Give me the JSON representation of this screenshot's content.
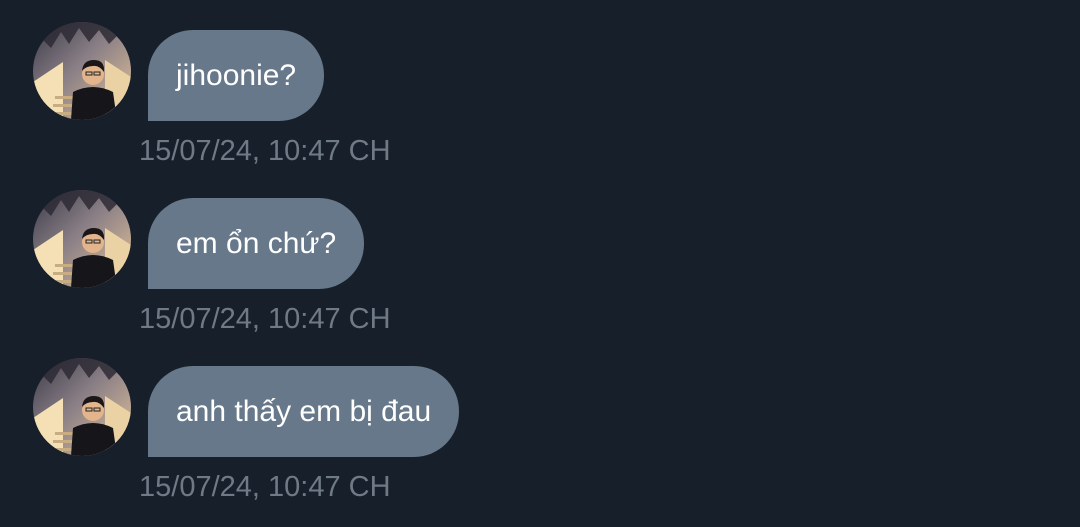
{
  "colors": {
    "background": "#17202a",
    "bubble": "#66788a",
    "bubble_text": "#ffffff",
    "timestamp": "#6f7a86"
  },
  "messages": [
    {
      "text": "jihoonie?",
      "time": "15/07/24, 10:47 CH",
      "avatar": "user-photo"
    },
    {
      "text": "em ổn chứ?",
      "time": "15/07/24, 10:47 CH",
      "avatar": "user-photo"
    },
    {
      "text": "anh thấy em bị đau",
      "time": "15/07/24, 10:47 CH",
      "avatar": "user-photo"
    }
  ]
}
